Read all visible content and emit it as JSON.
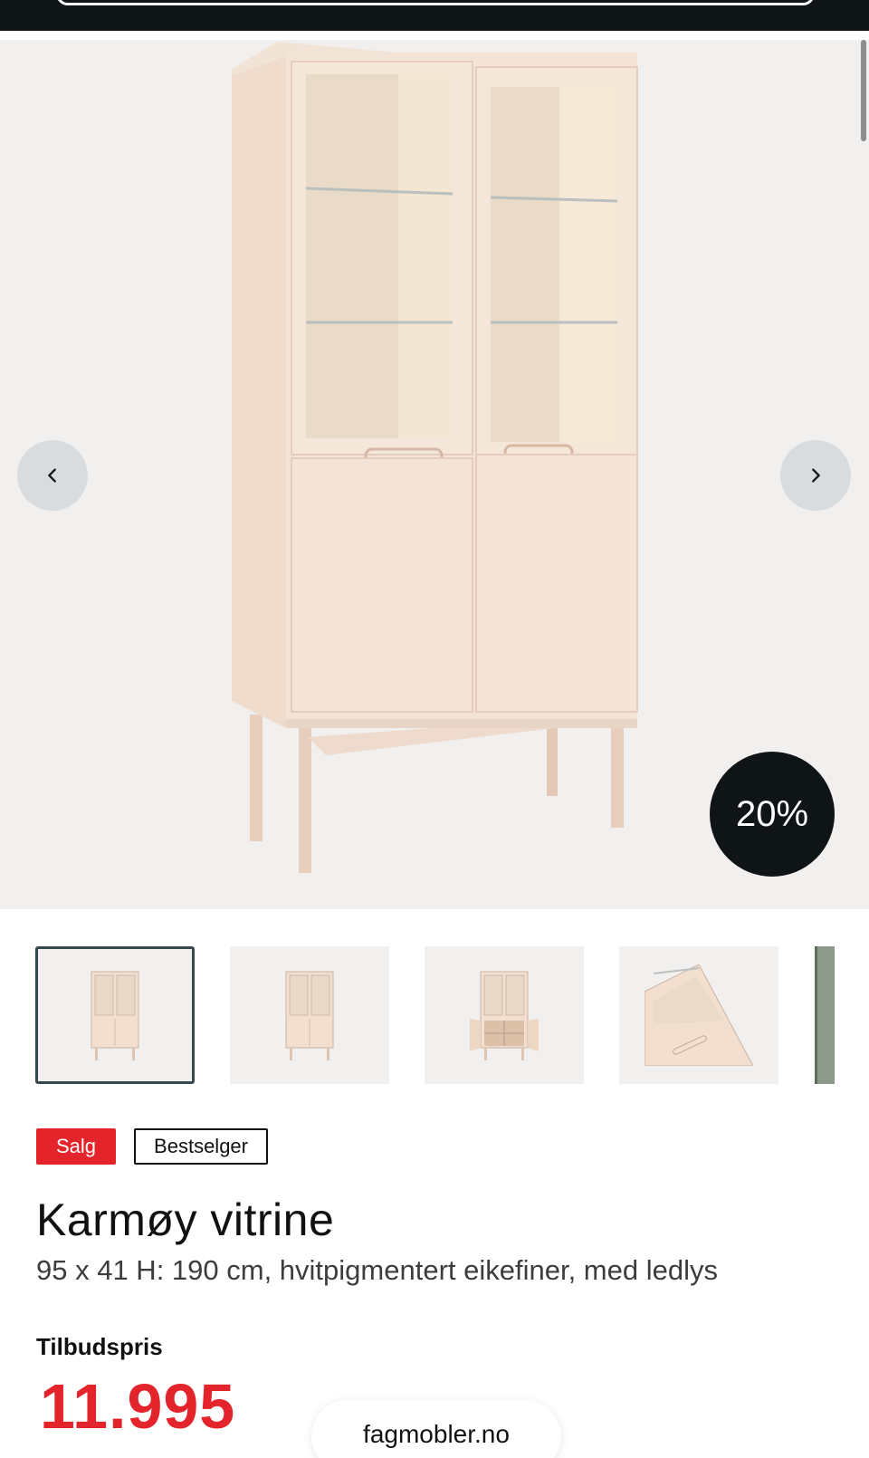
{
  "gallery": {
    "discount_badge": "20%",
    "image_count_visible_thumbnails": 5,
    "prev_icon": "chevron-left-icon",
    "next_icon": "chevron-right-icon",
    "thumbnails": [
      {
        "variant": "front-closed",
        "selected": true
      },
      {
        "variant": "front-closed",
        "selected": false
      },
      {
        "variant": "front-open",
        "selected": false
      },
      {
        "variant": "detail-corner",
        "selected": false
      },
      {
        "variant": "partial",
        "selected": false
      }
    ]
  },
  "badges": {
    "sale": "Salg",
    "bestseller": "Bestselger"
  },
  "product": {
    "title": "Karmøy vitrine",
    "description": "95 x 41 H: 190 cm, hvitpigmentert eikefiner, med ledlys"
  },
  "price": {
    "label": "Tilbudspris",
    "value": "11.995"
  },
  "browser": {
    "url": "fagmobler.no"
  },
  "colors": {
    "accent_red": "#e3242b",
    "dark": "#0f1416",
    "gallery_bg": "#f2f0ee"
  }
}
